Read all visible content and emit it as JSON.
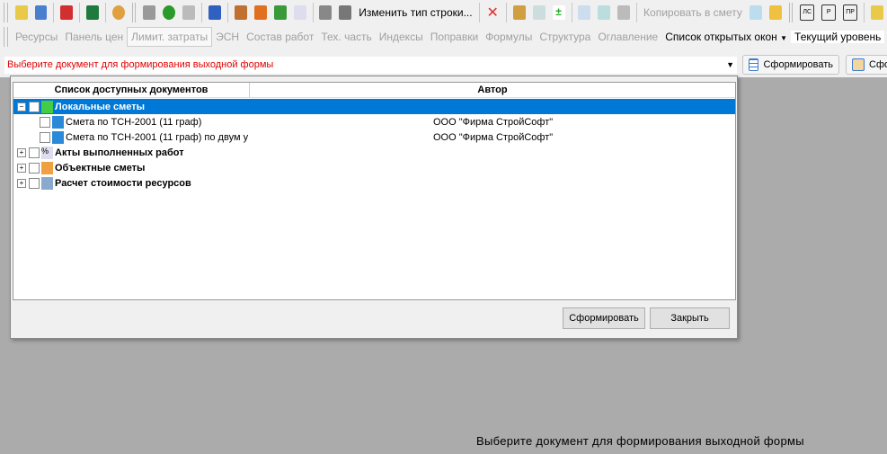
{
  "toolbar1": {
    "change_row_type": "Изменить тип строки...",
    "copy_to_estimate": "Копировать в смету",
    "badges": [
      "ЛС",
      "Р",
      "ПР"
    ]
  },
  "toolbar2": {
    "items": [
      "Ресурсы",
      "Панель цен",
      "Лимит. затраты",
      "ЭСН",
      "Состав работ",
      "Тех. часть",
      "Индексы",
      "Поправки",
      "Формулы",
      "Структура",
      "Оглавление"
    ],
    "open_windows": "Список открытых окон",
    "current_level": "Текущий уровень"
  },
  "doc_select": {
    "value": "Выберите документ для формирования выходной формы"
  },
  "form_button": "Сформировать",
  "form_button2": "Сфо",
  "dialog": {
    "columns": [
      "Список доступных документов",
      "Автор"
    ],
    "rows": [
      {
        "label": "Локальные сметы",
        "author": ""
      },
      {
        "label": "Смета по ТСН-2001 (11 граф)",
        "author": "ООО \"Фирма СтройСофт\""
      },
      {
        "label": "Смета по ТСН-2001 (11 граф) по двум у",
        "author": "ООО \"Фирма СтройСофт\""
      },
      {
        "label": "Акты выполненных работ",
        "author": ""
      },
      {
        "label": "Объектные сметы",
        "author": ""
      },
      {
        "label": "Расчет стоимости ресурсов",
        "author": ""
      }
    ],
    "form_label": "Сформировать",
    "close_label": "Закрыть"
  },
  "status": "Выберите документ для формирования выходной формы"
}
